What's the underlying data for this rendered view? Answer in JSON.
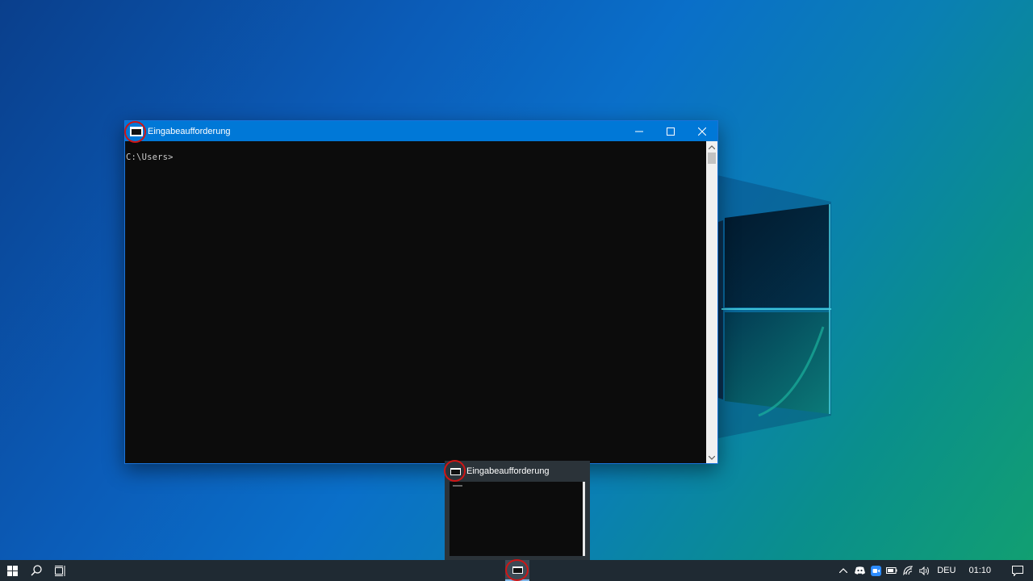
{
  "window": {
    "title": "Eingabeaufforderung",
    "console_text": "C:\\Users>"
  },
  "preview": {
    "title": "Eingabeaufforderung"
  },
  "taskbar": {
    "language": "DEU",
    "time": "01:10"
  },
  "icons": {
    "start": "windows-start-icon",
    "search": "search-icon",
    "task_view": "task-view-icon",
    "app": "command-prompt-icon",
    "tray": [
      "chevron-up-icon",
      "discord-icon",
      "zoom-icon",
      "battery-icon",
      "wifi-icon",
      "volume-icon"
    ],
    "notifications": "notification-icon"
  },
  "colors": {
    "accent": "#0078d7",
    "console_bg": "#0c0c0c",
    "taskbar_bg": "#1f2a33",
    "annotation": "#d01515"
  }
}
